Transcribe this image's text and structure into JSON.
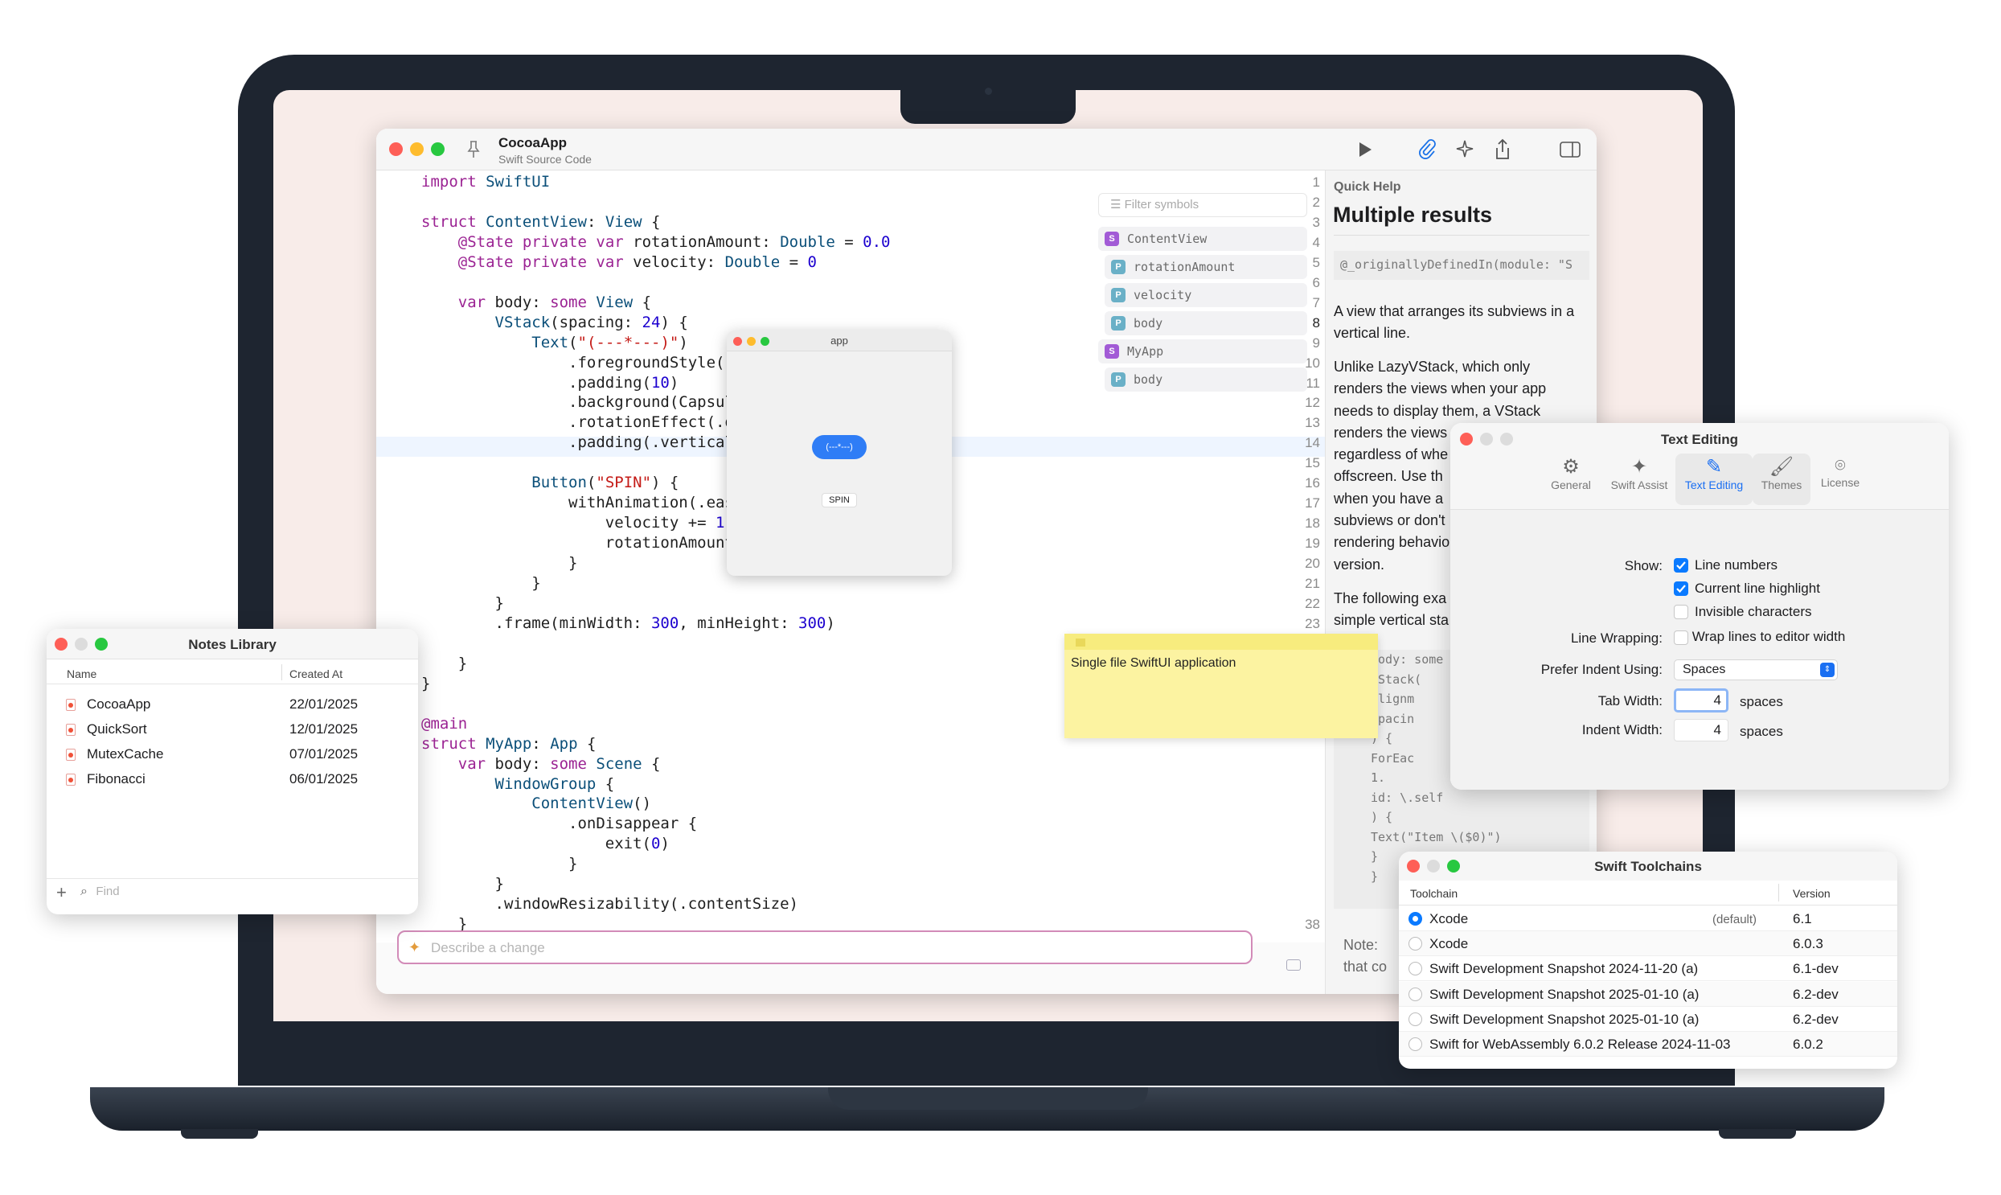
{
  "main_window": {
    "title": "CocoaApp",
    "subtitle": "Swift Source Code",
    "filter_placeholder": "Filter symbols",
    "code_lines": [
      {
        "n": "1",
        "text": "import SwiftUI"
      },
      {
        "n": "2",
        "text": ""
      },
      {
        "n": "3",
        "text": "struct ContentView: View {"
      },
      {
        "n": "4",
        "text": "    @State private var rotationAmount: Double = 0.0"
      },
      {
        "n": "5",
        "text": "    @State private var velocity: Double = 0"
      },
      {
        "n": "6",
        "text": ""
      },
      {
        "n": "7",
        "text": "    var body: some View {"
      },
      {
        "n": "8",
        "text": "        VStack(spacing: 24) {"
      },
      {
        "n": "9",
        "text": "            Text(\"(---*---)\")"
      },
      {
        "n": "10",
        "text": "                .foregroundStyle(."
      },
      {
        "n": "11",
        "text": "                .padding(10)"
      },
      {
        "n": "12",
        "text": "                .background(Capsul"
      },
      {
        "n": "13",
        "text": "                .rotationEffect(.d"
      },
      {
        "n": "14",
        "text": "                .padding(.vertical"
      },
      {
        "n": "15",
        "text": ""
      },
      {
        "n": "16",
        "text": "            Button(\"SPIN\") {"
      },
      {
        "n": "17",
        "text": "                withAnimation(.eas"
      },
      {
        "n": "18",
        "text": "                    velocity += 1"
      },
      {
        "n": "19",
        "text": "                    rotationAmount"
      },
      {
        "n": "20",
        "text": "                }"
      },
      {
        "n": "21",
        "text": "            }"
      },
      {
        "n": "22",
        "text": "        }"
      },
      {
        "n": "23",
        "text": "        .frame(minWidth: 300, minHeight: 300)"
      },
      {
        "n": "",
        "text": ""
      },
      {
        "n": "",
        "text": "    }"
      },
      {
        "n": "",
        "text": "}"
      },
      {
        "n": "",
        "text": ""
      },
      {
        "n": "",
        "text": "@main"
      },
      {
        "n": "",
        "text": "struct MyApp: App {"
      },
      {
        "n": "",
        "text": "    var body: some Scene {"
      },
      {
        "n": "",
        "text": "        WindowGroup {"
      },
      {
        "n": "",
        "text": "            ContentView()"
      },
      {
        "n": "",
        "text": "                .onDisappear {"
      },
      {
        "n": "",
        "text": "                    exit(0)"
      },
      {
        "n": "",
        "text": "                }"
      },
      {
        "n": "",
        "text": "        }"
      },
      {
        "n": "",
        "text": "        .windowResizability(.contentSize)"
      },
      {
        "n": "38",
        "text": "    }"
      }
    ],
    "symbols": [
      {
        "badge": "S",
        "name": "ContentView",
        "color": "#a25bd6"
      },
      {
        "badge": "P",
        "name": "rotationAmount",
        "color": "#6ab0c7"
      },
      {
        "badge": "P",
        "name": "velocity",
        "color": "#6ab0c7"
      },
      {
        "badge": "P",
        "name": "body",
        "color": "#6ab0c7"
      },
      {
        "badge": "S",
        "name": "MyApp",
        "color": "#a25bd6"
      },
      {
        "badge": "P",
        "name": "body",
        "color": "#6ab0c7"
      }
    ],
    "quick_help": {
      "label": "Quick Help",
      "heading": "Multiple results",
      "declaration": "@_originallyDefinedIn(module: \"S",
      "para1": "A view that arranges its subviews in a vertical line.",
      "para2_lines": [
        "Unlike LazyVStack, which only",
        "renders the views when your app",
        "needs to display them, a VStack",
        "renders the views",
        "regardless of whe",
        "offscreen. Use th",
        "when you have a",
        "subviews or don't",
        "rendering behavio",
        "version."
      ],
      "para3_lines": [
        "The following exa",
        "simple vertical sta"
      ],
      "code_lines": [
        "body: some",
        "VStack(",
        "  alignm",
        "  spacin",
        ") {",
        "  ForEac",
        "    1.",
        "    id: \\.self",
        ") {",
        "    Text(\"Item \\($0)\")",
        "  }",
        "}"
      ],
      "note_lines": [
        "Note:",
        "that co"
      ]
    },
    "prompt_placeholder": "Describe a change"
  },
  "app_window": {
    "title": "app",
    "capsule_text": "(---*---)",
    "button_label": "SPIN"
  },
  "notes_library": {
    "title": "Notes Library",
    "columns": [
      "Name",
      "Created At"
    ],
    "rows": [
      {
        "name": "CocoaApp",
        "date": "22/01/2025"
      },
      {
        "name": "QuickSort",
        "date": "12/01/2025"
      },
      {
        "name": "MutexCache",
        "date": "07/01/2025"
      },
      {
        "name": "Fibonacci",
        "date": "06/01/2025"
      }
    ],
    "add_label": "+",
    "find_placeholder": "Find"
  },
  "sticky_note": {
    "text": "Single file SwiftUI application"
  },
  "text_editing": {
    "title": "Text Editing",
    "tabs": [
      "General",
      "Swift Assist",
      "Text Editing",
      "Themes",
      "License"
    ],
    "show_label": "Show:",
    "show_options": [
      {
        "label": "Line numbers",
        "checked": true
      },
      {
        "label": "Current line highlight",
        "checked": true
      },
      {
        "label": "Invisible characters",
        "checked": false
      }
    ],
    "wrapping_label": "Line Wrapping:",
    "wrapping_option": "Wrap lines to editor width",
    "indent_using_label": "Prefer Indent Using:",
    "indent_using_value": "Spaces",
    "tab_width_label": "Tab Width:",
    "tab_width_value": "4",
    "tab_width_unit": "spaces",
    "indent_width_label": "Indent Width:",
    "indent_width_value": "4",
    "indent_width_unit": "spaces"
  },
  "toolchains": {
    "title": "Swift Toolchains",
    "columns": [
      "Toolchain",
      "Version"
    ],
    "rows": [
      {
        "name": "Xcode",
        "note": "(default)",
        "version": "6.1",
        "selected": true
      },
      {
        "name": "Xcode",
        "note": "",
        "version": "6.0.3",
        "selected": false
      },
      {
        "name": "Swift Development Snapshot 2024-11-20 (a)",
        "note": "",
        "version": "6.1-dev",
        "selected": false
      },
      {
        "name": "Swift Development Snapshot 2025-01-10 (a)",
        "note": "",
        "version": "6.2-dev",
        "selected": false
      },
      {
        "name": "Swift Development Snapshot 2025-01-10 (a)",
        "note": "",
        "version": "6.2-dev",
        "selected": false
      },
      {
        "name": "Swift for WebAssembly 6.0.2 Release 2024-11-03",
        "note": "",
        "version": "6.0.2",
        "selected": false
      }
    ]
  }
}
